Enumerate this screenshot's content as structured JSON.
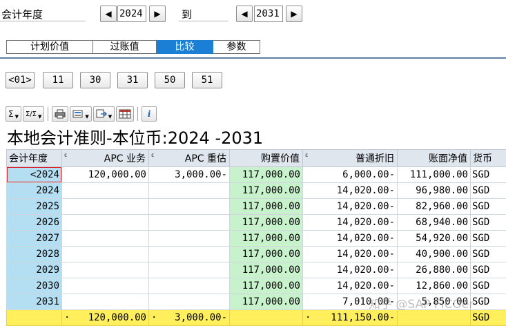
{
  "selection": {
    "year_label": "会计年度",
    "to_label": "到",
    "from_year": "2024",
    "to_year": "2031",
    "prev_icon": "triangle-left",
    "next_icon": "triangle-right"
  },
  "tabs": [
    {
      "label": "计划价值",
      "active": false
    },
    {
      "label": "过账值",
      "active": false
    },
    {
      "label": "比较",
      "active": true
    },
    {
      "label": "参数",
      "active": false
    }
  ],
  "value_buttons": [
    "<01>",
    "11",
    "30",
    "31",
    "50",
    "51"
  ],
  "toolbar": {
    "sum_label": "Σ",
    "subtotal_label": "Σ/Σ",
    "print_icon": "printer-icon",
    "view_icon": "view-icon",
    "export_icon": "export-icon",
    "layout_icon": "layout-grid-icon",
    "info_label": "i"
  },
  "grid": {
    "title": "本地会计准则-本位币:2024 -2031",
    "columns": [
      "会计年度",
      "APC 业务",
      "APC 重估",
      "购置价值",
      "普通折旧",
      "账面净值",
      "货币"
    ],
    "rows": [
      {
        "year": "<2024",
        "apc_txn": "120,000.00",
        "apc_reval": "3,000.00-",
        "acq_value": "117,000.00",
        "ord_dep": "6,000.00-",
        "nbv": "111,000.00",
        "currency": "SGD"
      },
      {
        "year": "2024",
        "apc_txn": "",
        "apc_reval": "",
        "acq_value": "117,000.00",
        "ord_dep": "14,020.00-",
        "nbv": "96,980.00",
        "currency": "SGD"
      },
      {
        "year": "2025",
        "apc_txn": "",
        "apc_reval": "",
        "acq_value": "117,000.00",
        "ord_dep": "14,020.00-",
        "nbv": "82,960.00",
        "currency": "SGD"
      },
      {
        "year": "2026",
        "apc_txn": "",
        "apc_reval": "",
        "acq_value": "117,000.00",
        "ord_dep": "14,020.00-",
        "nbv": "68,940.00",
        "currency": "SGD"
      },
      {
        "year": "2027",
        "apc_txn": "",
        "apc_reval": "",
        "acq_value": "117,000.00",
        "ord_dep": "14,020.00-",
        "nbv": "54,920.00",
        "currency": "SGD"
      },
      {
        "year": "2028",
        "apc_txn": "",
        "apc_reval": "",
        "acq_value": "117,000.00",
        "ord_dep": "14,020.00-",
        "nbv": "40,900.00",
        "currency": "SGD"
      },
      {
        "year": "2029",
        "apc_txn": "",
        "apc_reval": "",
        "acq_value": "117,000.00",
        "ord_dep": "14,020.00-",
        "nbv": "26,880.00",
        "currency": "SGD"
      },
      {
        "year": "2030",
        "apc_txn": "",
        "apc_reval": "",
        "acq_value": "117,000.00",
        "ord_dep": "14,020.00-",
        "nbv": "12,860.00",
        "currency": "SGD"
      },
      {
        "year": "2031",
        "apc_txn": "",
        "apc_reval": "",
        "acq_value": "117,000.00",
        "ord_dep": "7,010.00-",
        "nbv": "5,850.00",
        "currency": "SGD"
      }
    ],
    "total": {
      "year": "",
      "apc_txn": "120,000.00",
      "apc_reval": "3,000.00-",
      "acq_value": "",
      "ord_dep": "111,150.00-",
      "nbv": "",
      "currency": "SGD",
      "marker": "·"
    }
  },
  "watermark": "知乎 @SAP FICOer",
  "colors": {
    "key_column": "#b4dff2",
    "acq_value_column": "#c7f2cc",
    "total_row": "#ffef5c",
    "active_tab": "#1c7fd6"
  }
}
